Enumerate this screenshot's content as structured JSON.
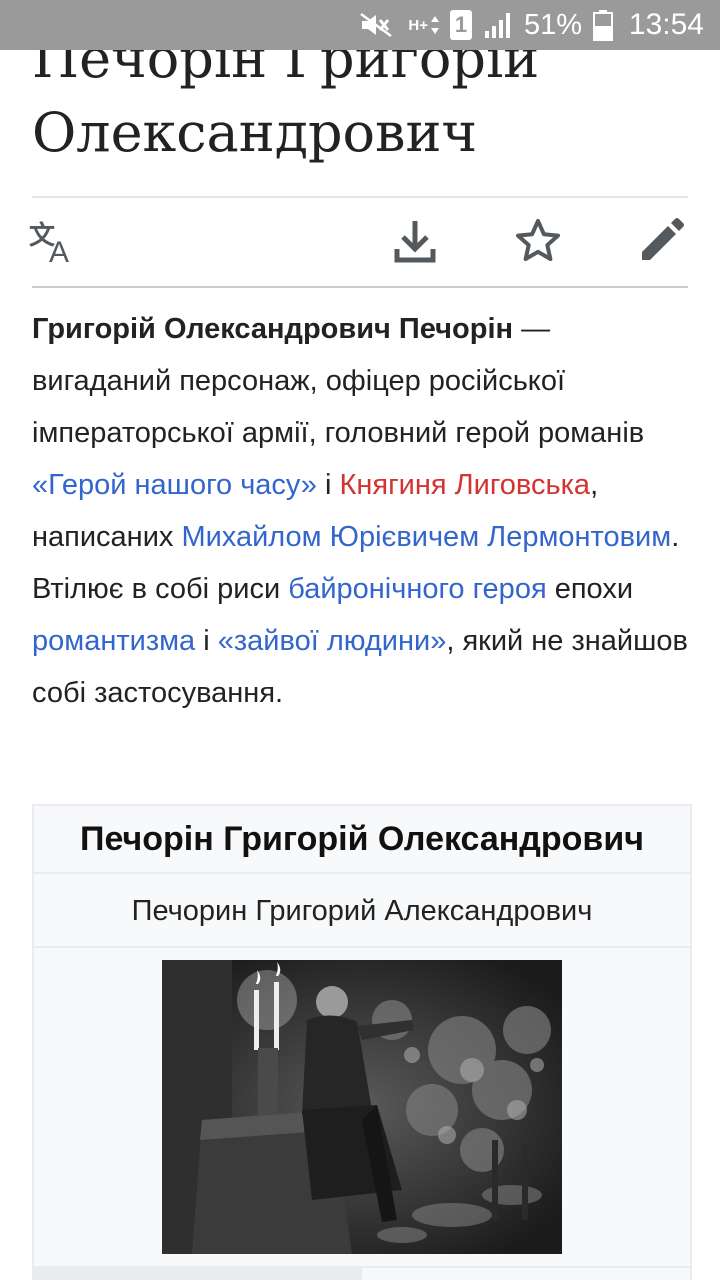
{
  "status_bar": {
    "time": "13:54",
    "battery_percent": "51%",
    "sim_slot": "1",
    "network_type": "H+",
    "icons": [
      "mute-icon",
      "network-type-icon",
      "sim-icon",
      "signal-icon",
      "battery-icon"
    ]
  },
  "article": {
    "title": "Печорін Григорій Олександрович",
    "lead": {
      "subject_bold": "Григорій Олександрович Печорін",
      "t1": " — вигаданий персонаж, офіцер російської імператорської армії, головний герой романів ",
      "link_hero": "«Герой нашого часу»",
      "t2": " і ",
      "link_knyahynia": "Княгиня Лиговська",
      "t3": ", написаних ",
      "link_lermontov": "Михайлом Юрієвичем Лермонтовим",
      "t4": ". Втілює в собі риси ",
      "link_byronic": "байронічного героя",
      "t5": " епохи ",
      "link_romanticism": "романтизма",
      "t6": " і ",
      "link_superfluous": "«зайвої людини»",
      "t7": ", який не знайшов собі застосування."
    }
  },
  "toolbar": {
    "icons": [
      "language-icon",
      "download-icon",
      "star-icon",
      "edit-icon"
    ]
  },
  "infobox": {
    "title": "Печорін Григорій Олександрович",
    "original_name": "Печорин Григорий Александрович"
  },
  "colors": {
    "link": "#3366cc",
    "redlink": "#d33333",
    "status_bar": "#9a9a9a",
    "text": "#222222",
    "icon": "#54595d"
  }
}
